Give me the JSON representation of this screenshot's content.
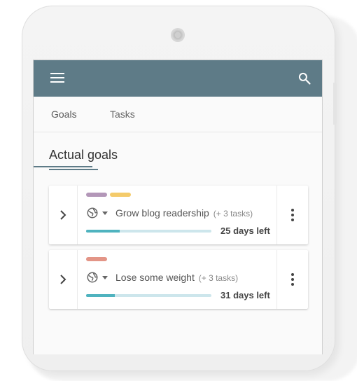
{
  "tabs": [
    {
      "label": "Goals",
      "active": true
    },
    {
      "label": "Tasks",
      "active": false
    }
  ],
  "section_title": "Actual goals",
  "goals": [
    {
      "tags": [
        "#b397b8",
        "#f4cb6b"
      ],
      "name": "Grow blog readership",
      "subtasks": "(+ 3 tasks)",
      "progress": 0.27,
      "days_left": "25 days left"
    },
    {
      "tags": [
        "#e39587"
      ],
      "name": "Lose some weight",
      "subtasks": "(+ 3 tasks)",
      "progress": 0.23,
      "days_left": "31 days left"
    }
  ],
  "colors": {
    "appbar": "#5e7b87",
    "progress_fill": "#4fb3bf",
    "progress_track": "#cde6ec"
  },
  "icons": {
    "menu": "menu-icon",
    "search": "search-icon",
    "expand": "chevron-right-icon",
    "visibility": "globe-icon",
    "more": "more-vert-icon"
  }
}
